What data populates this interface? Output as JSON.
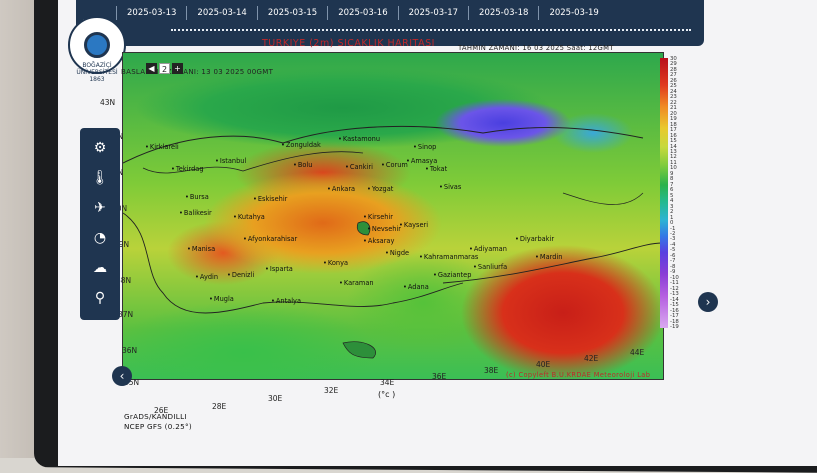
{
  "dates": [
    "2025-03-13",
    "2025-03-14",
    "2025-03-15",
    "2025-03-16",
    "2025-03-17",
    "2025-03-18",
    "2025-03-19"
  ],
  "logo_text": "BOĞAZİÇİ ÜNİVERSİTESİ 1863",
  "map": {
    "title": "TURKIYE (2m) SICAKLIK HARITASI",
    "forecast_time": "TAHMIN ZAMANI: 16 03 2025 Saat: 12GMT",
    "base_time": "BASLANGIC ZAMANI: 13 03 2025 00GMT",
    "pager": {
      "prev": "◀",
      "page": "2",
      "next": "+"
    },
    "unit": "(°c )",
    "copyright": "(c) Copyleft B.U.KRDAE Meteoroloji Lab",
    "footer_line1": "GrADS/KANDILLI",
    "footer_line2": "NCEP GFS (0.25°)",
    "lat_labels": [
      "43N",
      "42N",
      "41N",
      "40N",
      "39N",
      "38N",
      "37N",
      "36N",
      "35N"
    ],
    "lon_labels": [
      "26E",
      "28E",
      "30E",
      "32E",
      "34E",
      "36E",
      "38E",
      "40E",
      "42E",
      "44E"
    ],
    "cities": [
      "Kirklareli",
      "Tekirdag",
      "Istanbul",
      "Zonguldak",
      "Kastamonu",
      "Sinop",
      "Bolu",
      "Cankiri",
      "Corum",
      "Amasya",
      "Tokat",
      "Sivas",
      "Bursa",
      "Eskisehir",
      "Ankara",
      "Yozgat",
      "Balikesir",
      "Kutahya",
      "Kirsehir",
      "Nevsehir",
      "Kayseri",
      "Manisa",
      "Afyonkarahisar",
      "Aksaray",
      "Nigde",
      "Konya",
      "Karaman",
      "Adiyaman",
      "Diyarbakir",
      "Kahramanmaras",
      "Gaziantep",
      "Sanliurfa",
      "Mardin",
      "Aydin",
      "Denizli",
      "Isparta",
      "Mugla",
      "Antalya",
      "Adana"
    ],
    "legend": [
      "30",
      "29",
      "28",
      "27",
      "26",
      "25",
      "24",
      "23",
      "22",
      "21",
      "20",
      "19",
      "18",
      "17",
      "16",
      "15",
      "14",
      "13",
      "12",
      "11",
      "10",
      "9",
      "8",
      "7",
      "6",
      "5",
      "4",
      "3",
      "2",
      "1",
      "0",
      "-1",
      "-2",
      "-3",
      "-4",
      "-5",
      "-6",
      "-7",
      "-8",
      "-9",
      "-10",
      "-11",
      "-12",
      "-13",
      "-14",
      "-15",
      "-16",
      "-17",
      "-18",
      "-19"
    ]
  },
  "toolbar": {
    "items": [
      "gear-icon",
      "thermometer-icon",
      "wind-icon",
      "gauge-icon",
      "cloud-sun-icon",
      "pin-icon"
    ]
  },
  "nav": {
    "prev": "‹",
    "next": "›"
  }
}
